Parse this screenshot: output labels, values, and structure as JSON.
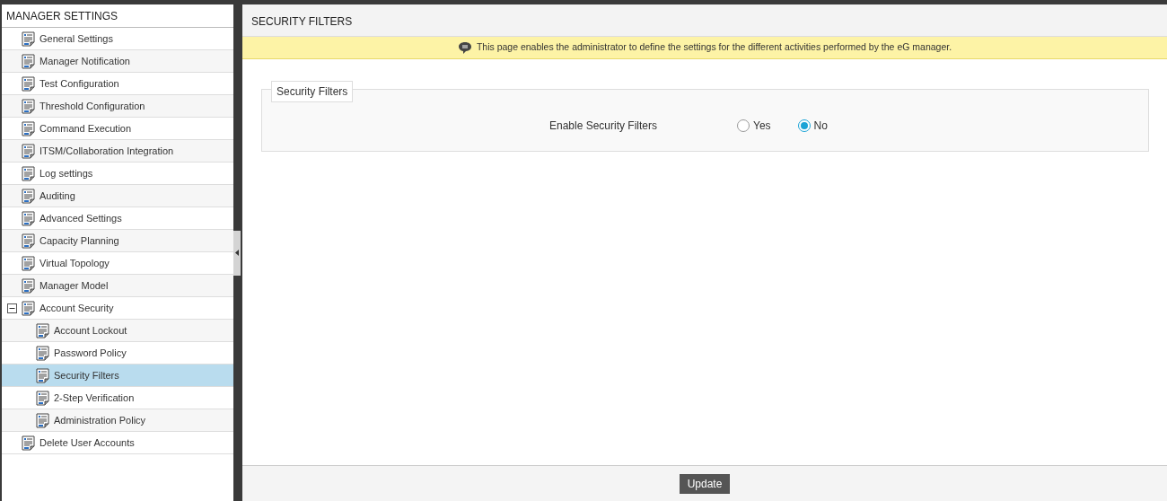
{
  "sidebar": {
    "title": "MANAGER SETTINGS",
    "items": [
      {
        "label": "General Settings",
        "selected": false
      },
      {
        "label": "Manager Notification",
        "selected": false
      },
      {
        "label": "Test Configuration",
        "selected": false
      },
      {
        "label": "Threshold Configuration",
        "selected": false
      },
      {
        "label": "Command Execution",
        "selected": false
      },
      {
        "label": "ITSM/Collaboration Integration",
        "selected": false
      },
      {
        "label": "Log settings",
        "selected": false
      },
      {
        "label": "Auditing",
        "selected": false
      },
      {
        "label": "Advanced Settings",
        "selected": false
      },
      {
        "label": "Capacity Planning",
        "selected": false
      },
      {
        "label": "Virtual Topology",
        "selected": false
      },
      {
        "label": "Manager Model",
        "selected": false
      },
      {
        "label": "Account Security",
        "selected": false,
        "expanded": true,
        "children": [
          {
            "label": "Account Lockout",
            "selected": false
          },
          {
            "label": "Password Policy",
            "selected": false
          },
          {
            "label": "Security Filters",
            "selected": true
          },
          {
            "label": "2-Step Verification",
            "selected": false
          },
          {
            "label": "Administration Policy",
            "selected": false
          }
        ]
      },
      {
        "label": "Delete User Accounts",
        "selected": false
      }
    ]
  },
  "main": {
    "title": "SECURITY FILTERS",
    "notice": "This page enables the administrator to define the settings for the different activities performed by the eG manager.",
    "fieldset": {
      "legend": "Security Filters",
      "label": "Enable Security Filters",
      "options": [
        {
          "label": "Yes",
          "selected": false
        },
        {
          "label": "No",
          "selected": true
        }
      ]
    },
    "button": "Update"
  }
}
